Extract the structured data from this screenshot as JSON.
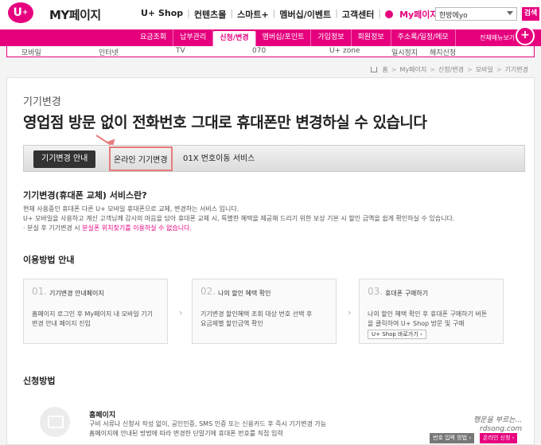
{
  "header": {
    "logo": "U",
    "logo_plus": "+",
    "brand": "MY페이지",
    "nav": [
      "U+ Shop",
      "컨텐츠몰",
      "스마트+",
      "멤버십/이벤트",
      "고객센터",
      "My페이지"
    ],
    "user_select": "한방에yo",
    "search_label": "검색"
  },
  "gnb": {
    "items": [
      "요금조회",
      "납부관리",
      "신청/변경",
      "멤버십/포인트",
      "가입정보",
      "회원정보",
      "주소록/일정/메모"
    ],
    "active": "신청/변경",
    "menu_all": "전체메뉴보기",
    "plus": "+"
  },
  "subnav": {
    "items": [
      "모바일",
      "인터넷",
      "TV",
      "070",
      "U+ zone",
      "일시정지",
      "해지신청"
    ]
  },
  "breadcrumb": [
    "홈",
    "My페이지",
    "신청/변경",
    "모바일",
    "기기변경"
  ],
  "page": {
    "section": "기기변경",
    "headline": "영업점 방문 없이 전화번호 그대로 휴대폰만 변경하실 수 있습니다"
  },
  "tabs": {
    "guide": "기기변경 안내",
    "online": "온라인 기기변경",
    "mnp": "01X 번호이동 서비스"
  },
  "intro": {
    "title": "기기변경(휴대폰 교체) 서비스란?",
    "line1": "현재 사용중인 휴대폰 다른 U+ 모바일 휴대폰으로 교체, 변경하는 서비스 입니다.",
    "line2": "U+ 모바일을 사용하고 계신 고객님께 감사의 마음을 담아 휴대폰 교체 시, 특별한 혜택을 제공해 드리기 위한 보상 기본 시 할인 금액을 쉽게 확인하실 수 있습니다.",
    "line3_prefix": "· 분실 후 기기변경 시 ",
    "line3_link": "분실폰 위치찾기를 이용하실 수 없습니다."
  },
  "usage": {
    "title": "이용방법 안내",
    "steps": [
      {
        "num": "01.",
        "label": "기기변경 안내페이지",
        "desc1": "홈페이지 로그인 후 My페이지 내 모바일 기기",
        "desc2": "변경 안내 페이지 진입"
      },
      {
        "num": "02.",
        "label": "나의 할인 혜택 확인",
        "desc1": "기기변경 할인혜택 조회 대상 번호 선택 후",
        "desc2": "요금제별 할인금액 확인"
      },
      {
        "num": "03.",
        "label": "휴대폰 구매하기",
        "desc1": "나의 할인 혜택 확인 후 휴대폰 구매하기 버튼",
        "desc2": "을 클릭하여 U+ Shop 방문 및 구매",
        "button": "U+ Shop 바로가기 ›"
      }
    ],
    "arrow": "›"
  },
  "apply": {
    "title": "신청방법",
    "home_label": "홈페이지",
    "desc1": "구비 서류나 신청서 작성 없이, 공인인증, SMS 인증 또는 신용카드 후 즉시 기기변경 가능",
    "desc2": "홈페이지에 안내된 방법에 따라 변경한 단말기에 휴대폰 번호를 직접 입력",
    "btn_number": "번호 입력 방법 ›",
    "btn_online": "온라인 신청 ›"
  },
  "watermark": {
    "line1": "행운을 부르는...",
    "line2": "rdsong.com"
  }
}
